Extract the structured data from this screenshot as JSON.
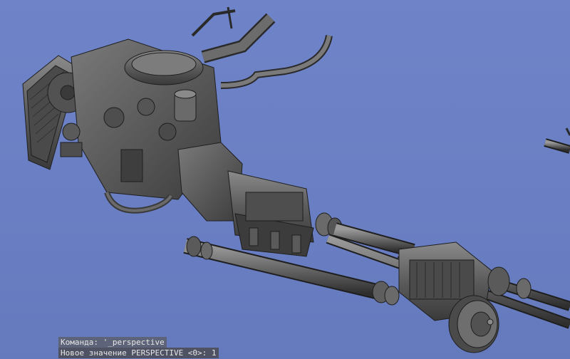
{
  "viewport": {
    "background_color": "#6b7fc4",
    "model_color": "#5a5a5a",
    "edge_color": "#1e1e1e",
    "projection": "perspective"
  },
  "command_line": {
    "prompt_label": "Команда:",
    "prompt_value": "'_perspective",
    "output_text": "Новое значение PERSPECTIVE <0>: 1"
  }
}
